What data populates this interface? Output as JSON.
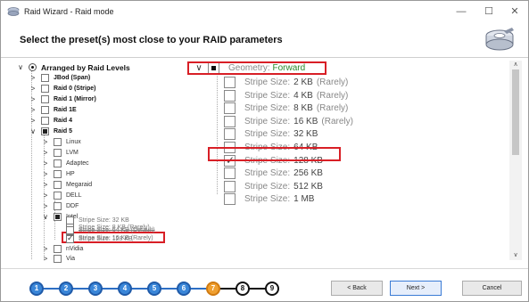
{
  "window": {
    "title": "Raid Wizard - Raid mode",
    "minimize": "—",
    "maximize": "☐",
    "close": "✕"
  },
  "header": {
    "text": "Select the preset(s) most close to your RAID parameters",
    "icon": "hdd-icon"
  },
  "tree": {
    "root": "Arranged by Raid Levels",
    "levels": [
      "JBod (Span)",
      "Raid 0 (Stripe)",
      "Raid 1 (Mirror)",
      "Raid 1E",
      "Raid 4",
      "Raid 5"
    ],
    "raid5_children": [
      "Linux",
      "LVM",
      "Adaptec",
      "HP",
      "Megaraid",
      "DELL",
      "DDF",
      "Intel"
    ],
    "intel_children": [
      "Stripe Size:  8 KB (Rarely)",
      "Stripe Size:  16 KB (Rarely)",
      "Stripe Size:  32 KB",
      "Stripe Size:  64 KB (Default)",
      "Stripe Size:  128 KB"
    ],
    "after": [
      "nVidia",
      "Via"
    ]
  },
  "right": {
    "geometry_label": "Geometry:",
    "geometry_value": "Forward",
    "prefix": "Stripe Size:",
    "sizes": [
      {
        "value": "2 KB",
        "note": "(Rarely)"
      },
      {
        "value": "4 KB",
        "note": "(Rarely)"
      },
      {
        "value": "8 KB",
        "note": "(Rarely)"
      },
      {
        "value": "16 KB",
        "note": "(Rarely)"
      },
      {
        "value": "32 KB",
        "note": ""
      },
      {
        "value": "64 KB",
        "note": ""
      },
      {
        "value": "128 KB",
        "note": ""
      },
      {
        "value": "256 KB",
        "note": ""
      },
      {
        "value": "512 KB",
        "note": ""
      },
      {
        "value": "1 MB",
        "note": ""
      }
    ]
  },
  "steps": [
    "1",
    "2",
    "3",
    "4",
    "5",
    "6",
    "7",
    "8",
    "9"
  ],
  "buttons": {
    "back": "< Back",
    "next": "Next >",
    "cancel": "Cancel"
  },
  "colors": {
    "accent": "#3a86d8",
    "current_step": "#f0a030",
    "highlight": "#d81f26",
    "geometry": "#2a8a2a"
  }
}
